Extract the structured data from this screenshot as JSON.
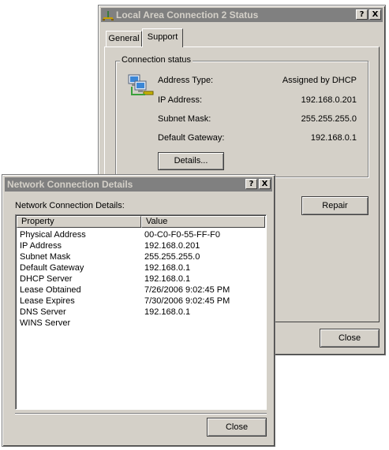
{
  "status_window": {
    "title": "Local Area Connection 2 Status",
    "help_button": "?",
    "close_button": "X",
    "tabs": [
      {
        "label": "General"
      },
      {
        "label": "Support"
      }
    ],
    "group_label": "Connection status",
    "fields": [
      {
        "label": "Address Type:",
        "value": "Assigned by DHCP"
      },
      {
        "label": "IP Address:",
        "value": "192.168.0.201"
      },
      {
        "label": "Subnet Mask:",
        "value": "255.255.255.0"
      },
      {
        "label": "Default Gateway:",
        "value": "192.168.0.1"
      }
    ],
    "details_button": "Details...",
    "repair_button": "Repair",
    "close_label": "Close"
  },
  "details_window": {
    "title": "Network Connection Details",
    "help_button": "?",
    "close_button": "X",
    "caption": "Network Connection Details:",
    "columns": [
      "Property",
      "Value"
    ],
    "rows": [
      {
        "property": "Physical Address",
        "value": "00-C0-F0-55-FF-F0"
      },
      {
        "property": "IP Address",
        "value": "192.168.0.201"
      },
      {
        "property": "Subnet Mask",
        "value": "255.255.255.0"
      },
      {
        "property": "Default Gateway",
        "value": "192.168.0.1"
      },
      {
        "property": "DHCP Server",
        "value": "192.168.0.1"
      },
      {
        "property": "Lease Obtained",
        "value": "7/26/2006 9:02:45 PM"
      },
      {
        "property": "Lease Expires",
        "value": "7/30/2006 9:02:45 PM"
      },
      {
        "property": "DNS Server",
        "value": "192.168.0.1"
      },
      {
        "property": "WINS Server",
        "value": ""
      }
    ],
    "close_label": "Close"
  }
}
